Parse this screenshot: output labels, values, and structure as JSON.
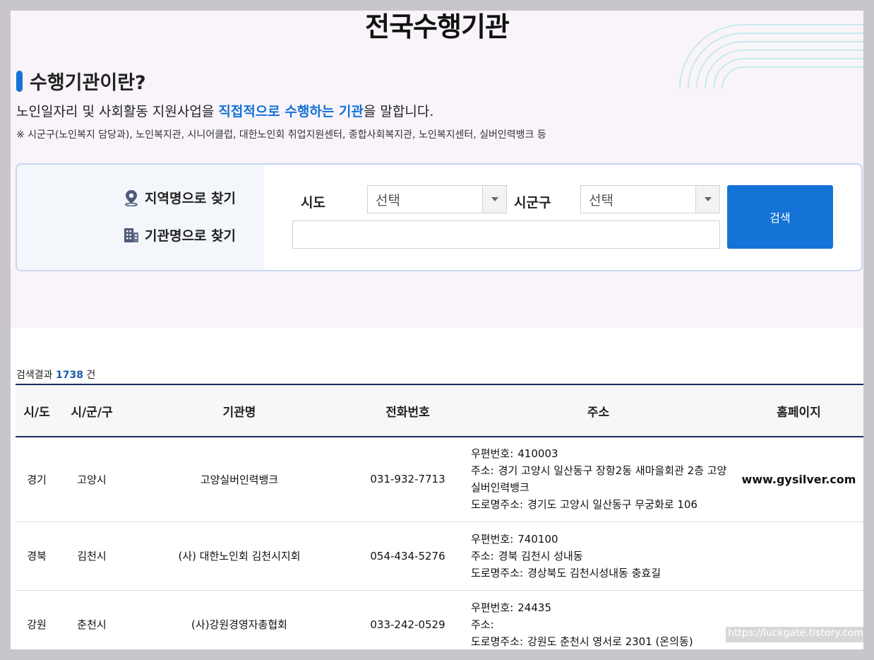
{
  "page_title": "전국수행기관",
  "intro": {
    "title": "수행기관이란?",
    "desc_before": "노인일자리 및 사회활동 지원사업을 ",
    "desc_highlight": "직접적으로 수행하는 기관",
    "desc_after": "을 말합니다.",
    "note": "※ 시군구(노인복지 담당과), 노인복지관, 시니어클럽, 대한노인회 취업지원센터, 종합사회복지관, 노인복지센터, 실버인력뱅크 등"
  },
  "search": {
    "find_by_region": "지역명으로 찾기",
    "find_by_name": "기관명으로 찾기",
    "sido_label": "시도",
    "sido_value": "선택",
    "sigungu_label": "시군구",
    "sigungu_value": "선택",
    "name_input_value": "",
    "button_label": "검색",
    "icons": {
      "region": "map-pin-icon",
      "name": "building-icon",
      "dropdown": "caret-down-icon"
    },
    "accent_color": "#1473d6"
  },
  "results": {
    "count_prefix": "검색결과 ",
    "count": "1738",
    "count_suffix": " 건",
    "headers": [
      "시/도",
      "시/군/구",
      "기관명",
      "전화번호",
      "주소",
      "홈페이지"
    ],
    "address_keys": {
      "zip": "우편번호:",
      "addr": "주소:",
      "road": "도로명주소:"
    },
    "rows": [
      {
        "sido": "경기",
        "sigungu": "고양시",
        "name": "고양실버인력뱅크",
        "tel": "031-932-7713",
        "zip": "410003",
        "addr": "경기 고양시 일산동구 장항2동 새마을회관 2층 고양실버인력뱅크",
        "road": "경기도 고양시 일산동구 무궁화로 106",
        "homepage": "www.gysilver.com"
      },
      {
        "sido": "경북",
        "sigungu": "김천시",
        "name": "(사) 대한노인회 김천시지회",
        "tel": "054-434-5276",
        "zip": "740100",
        "addr": "경북 김천시 성내동",
        "road": "경상북도 김천시성내동 충효길",
        "homepage": ""
      },
      {
        "sido": "강원",
        "sigungu": "춘천시",
        "name": "(사)강원경영자총협회",
        "tel": "033-242-0529",
        "zip": "24435",
        "addr": "",
        "road": "강원도 춘천시 영서로 2301 (온의동)",
        "homepage": ""
      }
    ]
  },
  "watermark": "https://luckgate.tistory.com"
}
